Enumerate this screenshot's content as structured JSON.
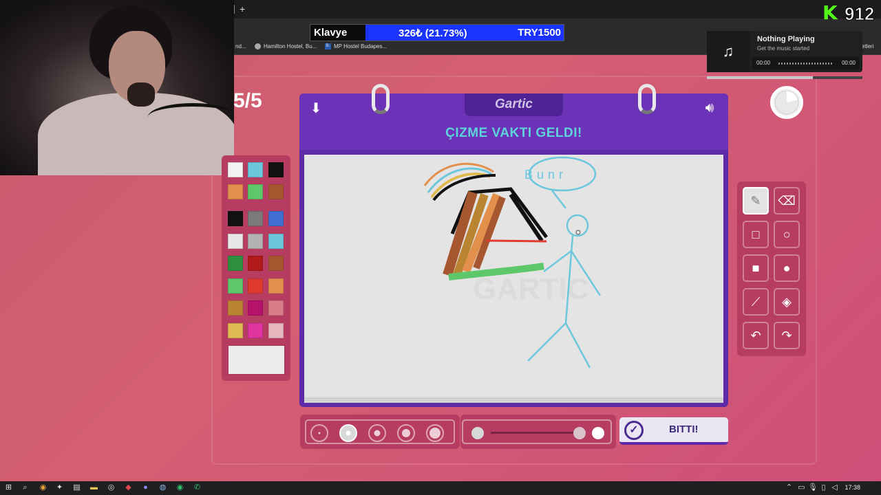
{
  "browser": {
    "bookmarks": [
      {
        "label": "nd..."
      },
      {
        "label": "Hamilton Hostel, Bu..."
      },
      {
        "label": "MP Hostel Budapes..."
      },
      {
        "label": "etleri"
      }
    ]
  },
  "stream_overlay": {
    "goal_label": "Klavye",
    "goal_amount": "326₺ (21.73%)",
    "goal_target": "TRY1500",
    "kick_count": "912",
    "kick_logo": "K"
  },
  "now_playing": {
    "title": "Nothing Playing",
    "subtitle": "Get the music started",
    "time_start": "00:00",
    "time_end": "00:00",
    "icon": "music-note-icon"
  },
  "game": {
    "round": "5/5",
    "logo": "Gartic",
    "title": "ÇIZME VAKTI GELDI!",
    "done_label": "BITTI!",
    "active_tool": "pencil",
    "active_thickness_index": 1,
    "canvas_text": "Bunr"
  },
  "palette": {
    "colors": [
      "#f2f2f2",
      "#6cc7dd",
      "#111111",
      "#e3904d",
      "#5dc76a",
      "#a7572f",
      "#111111",
      "#7a7a7a",
      "#3e6fd1",
      "#e6e6e6",
      "#b3b3b3",
      "#6cc7dd",
      "#2e8f3f",
      "#b01a1a",
      "#a7572f",
      "#5dc76a",
      "#e03a2e",
      "#e3904d",
      "#b98532",
      "#b5126b",
      "#d87e86",
      "#e0bb52",
      "#e0359f",
      "#e7b7c0"
    ],
    "current": "#ececec"
  },
  "tools": [
    {
      "name": "pencil-icon",
      "glyph": "✎"
    },
    {
      "name": "eraser-icon",
      "glyph": "⌫"
    },
    {
      "name": "rectangle-outline-icon",
      "glyph": "□"
    },
    {
      "name": "circle-outline-icon",
      "glyph": "○"
    },
    {
      "name": "rectangle-filled-icon",
      "glyph": "■"
    },
    {
      "name": "circle-filled-icon",
      "glyph": "●"
    },
    {
      "name": "line-icon",
      "glyph": "⟋"
    },
    {
      "name": "fill-bucket-icon",
      "glyph": "◈"
    },
    {
      "name": "undo-icon",
      "glyph": "↶"
    },
    {
      "name": "redo-icon",
      "glyph": "↷"
    }
  ],
  "taskbar": {
    "clock": "17:38"
  }
}
